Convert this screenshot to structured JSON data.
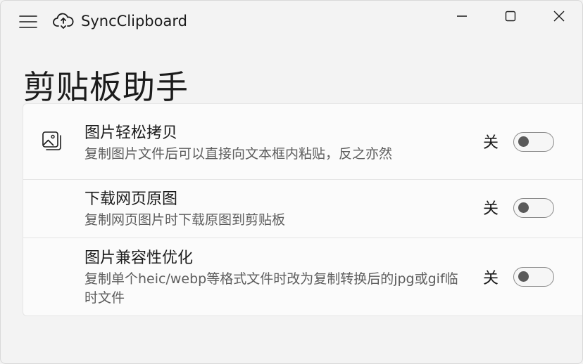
{
  "window": {
    "title": "SyncClipboard",
    "icons": {
      "menu": "hamburger-menu-icon",
      "app": "cloud-sync-icon",
      "minimize": "minimize-icon",
      "maximize": "maximize-icon",
      "close": "close-icon"
    }
  },
  "page": {
    "title": "剪贴板助手"
  },
  "settings": [
    {
      "title": "图片轻松拷贝",
      "description": "复制图片文件后可以直接向文本框内粘贴，反之亦然",
      "state_label": "关",
      "enabled": false,
      "icon": "image-copy-icon"
    },
    {
      "title": "下载网页原图",
      "description": "复制网页图片时下载原图到剪贴板",
      "state_label": "关",
      "enabled": false
    },
    {
      "title": "图片兼容性优化",
      "description": "复制单个heic/webp等格式文件时改为复制转换后的jpg或gif临时文件",
      "state_label": "关",
      "enabled": false
    }
  ],
  "colors": {
    "background": "#f3f3f3",
    "card": "#fbfbfb",
    "text": "#1b1b1b",
    "secondary_text": "#5d5d5d",
    "toggle_off_border": "#8a8a8a",
    "toggle_off_knob": "#5a5a5a"
  }
}
